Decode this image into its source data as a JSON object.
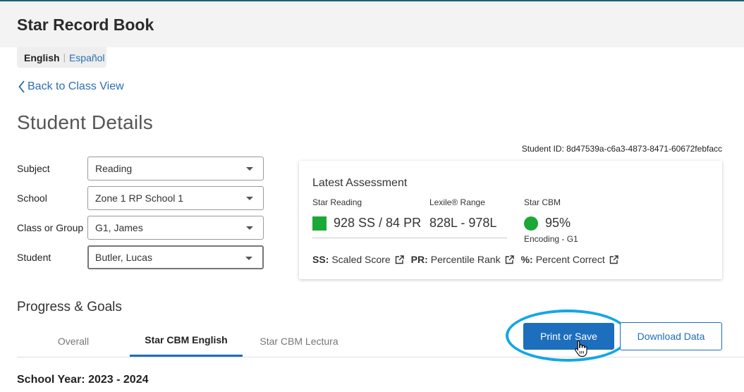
{
  "app": {
    "title": "Star Record Book"
  },
  "language": {
    "active": "English",
    "other": "Español"
  },
  "nav": {
    "back_label": "Back to Class View"
  },
  "page": {
    "title": "Student Details",
    "student_id": "Student ID: 8d47539a-c6a3-4873-8471-60672febfacc"
  },
  "filters": [
    {
      "label": "Subject",
      "value": "Reading"
    },
    {
      "label": "School",
      "value": "Zone 1 RP School 1"
    },
    {
      "label": "Class or Group",
      "value": "G1, James"
    },
    {
      "label": "Student",
      "value": "Butler, Lucas"
    }
  ],
  "assessment": {
    "title": "Latest Assessment",
    "star_reading": {
      "label": "Star Reading",
      "value": "928 SS / 84 PR",
      "color": "#1aa837"
    },
    "lexile": {
      "label": "Lexile® Range",
      "value": "828L - 978L"
    },
    "cbm": {
      "label": "Star CBM",
      "value": "95%",
      "sub": "Encoding - G1",
      "color": "#1aa837"
    },
    "legend": [
      {
        "abbr": "SS:",
        "text": "Scaled Score"
      },
      {
        "abbr": "PR:",
        "text": "Percentile Rank"
      },
      {
        "abbr": "%:",
        "text": "Percent Correct"
      }
    ]
  },
  "progress": {
    "title": "Progress & Goals",
    "tabs": [
      {
        "label": "Overall"
      },
      {
        "label": "Star CBM English"
      },
      {
        "label": "Star CBM Lectura"
      }
    ],
    "active_tab": "Star CBM English",
    "print_label": "Print or Save",
    "download_label": "Download Data",
    "school_year": "School Year: 2023 - 2024"
  },
  "colors": {
    "accent": "#1d6ebd",
    "link": "#2a6fb0",
    "highlight_ring": "#14a6e6",
    "status_green": "#1aa837"
  },
  "icons": [
    "chevron-left-icon",
    "caret-down-icon",
    "external-link-icon",
    "hand-pointer-icon"
  ]
}
